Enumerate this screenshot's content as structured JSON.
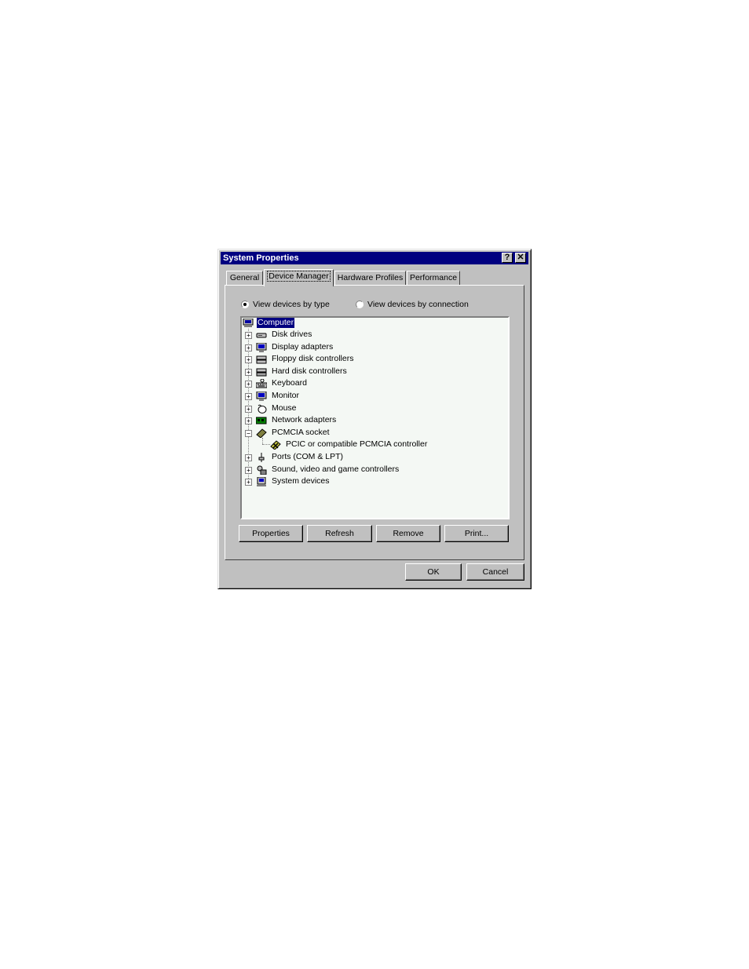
{
  "window": {
    "title": "System Properties",
    "help_glyph": "?",
    "close_glyph": "✕"
  },
  "tabs": [
    {
      "label": "General"
    },
    {
      "label": "Device Manager"
    },
    {
      "label": "Hardware Profiles"
    },
    {
      "label": "Performance"
    }
  ],
  "view_options": {
    "by_type": "View devices by type",
    "by_connection": "View devices by connection",
    "selected": "by_type"
  },
  "tree": {
    "root": "Computer",
    "items": [
      {
        "label": "Disk drives",
        "icon": "disk-drive-icon",
        "expanded": false
      },
      {
        "label": "Display adapters",
        "icon": "display-adapter-icon",
        "expanded": false
      },
      {
        "label": "Floppy disk controllers",
        "icon": "floppy-controller-icon",
        "expanded": false
      },
      {
        "label": "Hard disk controllers",
        "icon": "hard-disk-controller-icon",
        "expanded": false
      },
      {
        "label": "Keyboard",
        "icon": "keyboard-icon",
        "expanded": false
      },
      {
        "label": "Monitor",
        "icon": "monitor-icon",
        "expanded": false
      },
      {
        "label": "Mouse",
        "icon": "mouse-icon",
        "expanded": false
      },
      {
        "label": "Network adapters",
        "icon": "network-adapter-icon",
        "expanded": false
      },
      {
        "label": "PCMCIA socket",
        "icon": "pcmcia-icon",
        "expanded": true
      },
      {
        "label": "PCIC or compatible PCMCIA controller",
        "icon": "disabled-device-icon",
        "child": true
      },
      {
        "label": "Ports (COM & LPT)",
        "icon": "ports-icon",
        "expanded": false
      },
      {
        "label": "Sound, video and game controllers",
        "icon": "sound-icon",
        "expanded": false
      },
      {
        "label": "System devices",
        "icon": "system-devices-icon",
        "expanded": false
      }
    ]
  },
  "buttons": {
    "properties": "Properties",
    "refresh": "Refresh",
    "remove": "Remove",
    "print": "Print...",
    "ok": "OK",
    "cancel": "Cancel"
  },
  "colors": {
    "titlebar": "#000080",
    "face": "#c0c0c0",
    "selection": "#000080"
  }
}
